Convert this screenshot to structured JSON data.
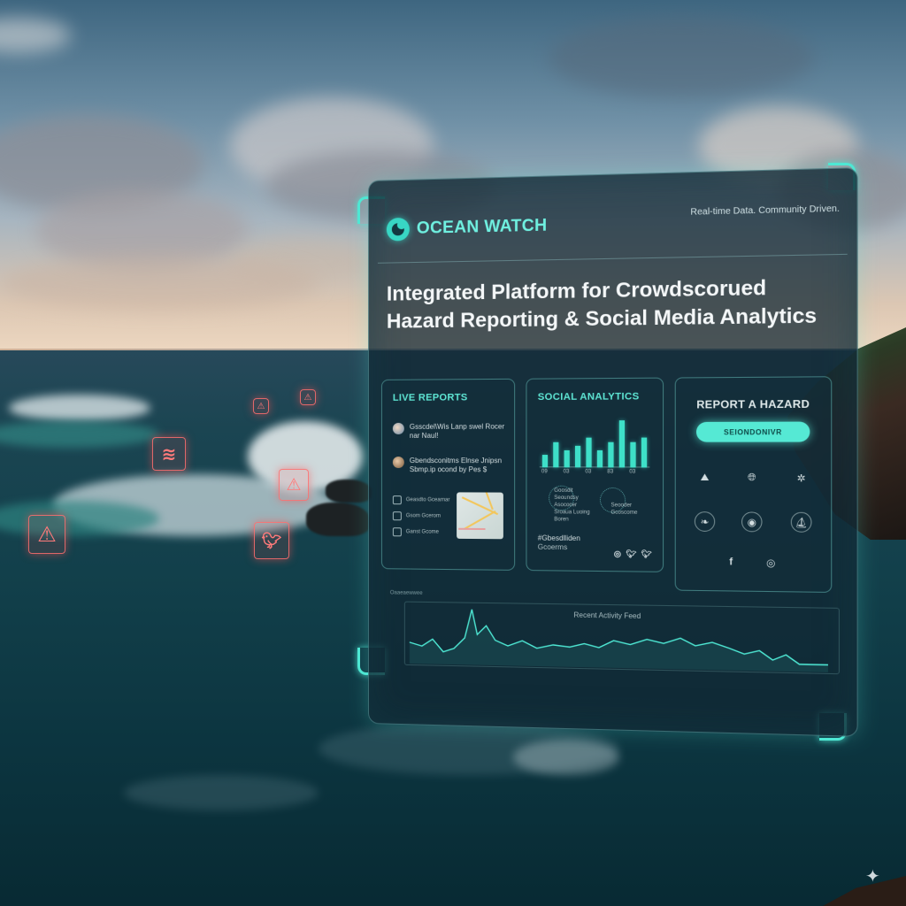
{
  "app": {
    "brand": "OCEAN WATCH",
    "tagline": "Real-time Data. Community Driven.",
    "headline": "Integrated Platform for Crowdscorued Hazard Reporting & Social Media Analytics"
  },
  "live_reports": {
    "title": "LIVE REPORTS",
    "items": [
      {
        "text": "Gsscdel\\Wis Lanp swel Rocer nar Naul!",
        "avatar": "avatar-1"
      },
      {
        "text": "Gbendsconitms Elnse Jnipsn Sbmp.ip ocond by Pes $",
        "avatar": "avatar-2"
      }
    ],
    "mini_rows": [
      "Geasdto Gcearnar",
      "Gsom Gcerom",
      "Ganst Gcome"
    ]
  },
  "social_analytics": {
    "title": "SOCIAL ANALYTICS",
    "chart_data": {
      "type": "bar",
      "values": [
        3,
        6,
        4,
        5,
        7,
        4,
        6,
        11,
        6,
        7
      ],
      "categories": [
        "09",
        "",
        "03",
        "",
        "03",
        "",
        "83",
        "",
        "03",
        ""
      ]
    },
    "lists": [
      [
        "Goosdit",
        "Seoundsy",
        "Asococer",
        "Sroaua Luoing",
        "Boren"
      ],
      [
        "Seooder",
        "Gcoscome"
      ]
    ],
    "hashtag": "#Gbesdlliden",
    "hashtag_sub": "Gcoerms",
    "icons": [
      "instagram-icon",
      "twitter-icon",
      "twitter-icon"
    ]
  },
  "report_hazard": {
    "title": "REPORT A HAZARD",
    "button": "SEIONDONIVR",
    "icons": [
      "tsunami-icon",
      "globe-icon",
      "debris-icon",
      "flood-icon",
      "swirl-icon",
      "boat-icon",
      "facebook-icon",
      "instagram-icon"
    ]
  },
  "activity_feed": {
    "small_label": "Oaaeaewwee",
    "label": "Recent Activity Feed"
  },
  "colors": {
    "accent": "#4ee8d4",
    "hazard": "#ff6b6b",
    "panel_bg": "#10263299"
  }
}
